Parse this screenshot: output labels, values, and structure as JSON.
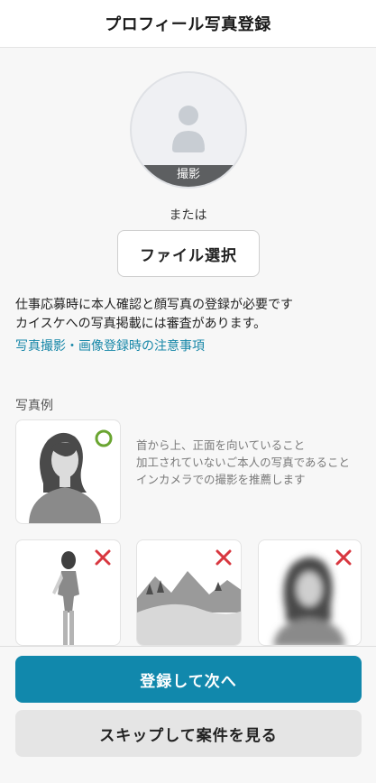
{
  "header": {
    "title": "プロフィール写真登録"
  },
  "avatar": {
    "capture_label": "撮影",
    "icon": "person-silhouette-icon"
  },
  "or_text": "または",
  "file_button": {
    "label": "ファイル選択"
  },
  "notice": {
    "lines": [
      "仕事応募時に本人確認と顔写真の登録が必要です",
      "カイスケへの写真掲載には審査があります。"
    ],
    "link": "写真撮影・画像登録時の注意事項"
  },
  "examples": {
    "label": "写真例",
    "good": {
      "icon": "check-circle-icon",
      "guidelines": [
        "首から上、正面を向いていること",
        "加工されていないご本人の写真であること",
        "インカメラでの撮影を推薦します"
      ]
    },
    "bad": [
      {
        "name": "full-body-example",
        "icon": "cross-icon"
      },
      {
        "name": "landscape-example",
        "icon": "cross-icon"
      },
      {
        "name": "blurred-example",
        "icon": "cross-icon"
      }
    ]
  },
  "actions": {
    "primary": "登録して次へ",
    "secondary": "スキップして案件を見る"
  },
  "colors": {
    "accent": "#1188ac",
    "link": "#1787a8",
    "ok": "#6aa531",
    "ng": "#d8373f"
  }
}
